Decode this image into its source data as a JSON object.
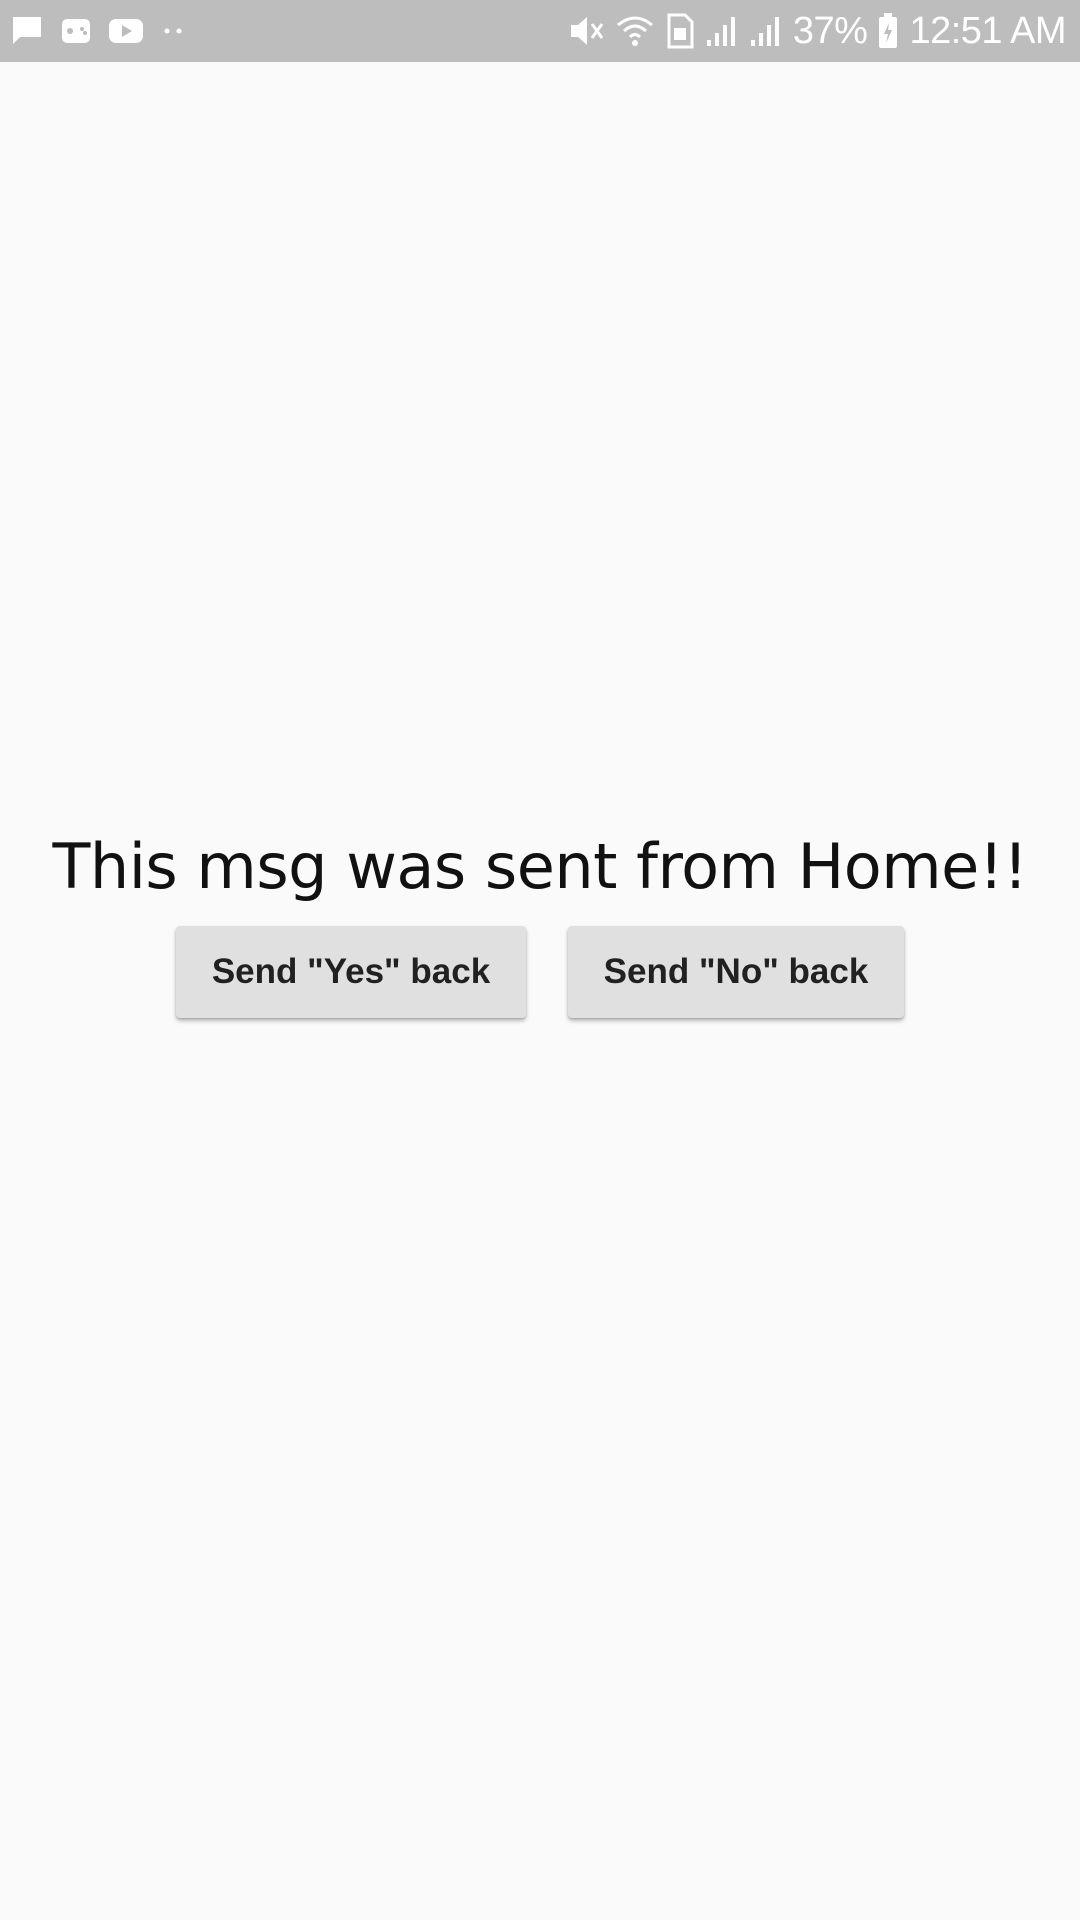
{
  "status_bar": {
    "battery_percent": "37%",
    "time": "12:51 AM",
    "left_icons": [
      "message-icon",
      "game-controller-icon",
      "youtube-icon",
      "more-dots-icon"
    ],
    "right_icons": [
      "mute-icon",
      "wifi-icon",
      "sim-icon",
      "signal-icon",
      "signal-icon",
      "battery-charging-icon"
    ]
  },
  "main": {
    "message": "This msg was sent from Home!!",
    "yes_button_label": "Send \"Yes\" back",
    "no_button_label": "Send \"No\" back"
  },
  "colors": {
    "status_bar_bg": "#bdbdbd",
    "page_bg": "#fafafa",
    "button_bg": "#e0e0e0",
    "button_text": "#212121"
  }
}
